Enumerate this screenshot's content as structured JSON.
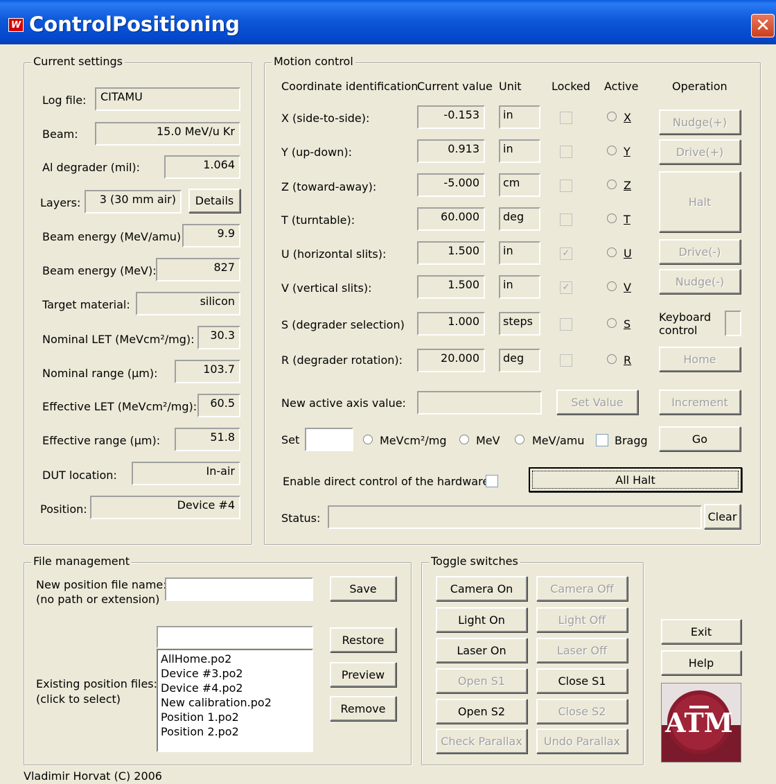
{
  "window": {
    "title": "ControlPositioning",
    "close_glyph": "✕",
    "app_icon": "app-icon"
  },
  "settings": {
    "legend": "Current settings",
    "log_label": "Log file:",
    "log_value": "CITAMU",
    "beam_label": "Beam:",
    "beam_value": "15.0 MeV/u  Kr",
    "al_label": "Al degrader (mil):",
    "al_value": "1.064",
    "layers_label": "Layers:",
    "layers_value": "3 (30 mm air)",
    "details_btn": "Details",
    "be_amu_label": "Beam energy (MeV/amu):",
    "be_amu_value": "9.9",
    "be_label": "Beam energy (MeV):",
    "be_value": "827",
    "target_label": "Target material:",
    "target_value": "silicon",
    "nlet_label": "Nominal LET (MeVcm²/mg):",
    "nlet_value": "30.3",
    "nrange_label": "Nominal range (µm):",
    "nrange_value": "103.7",
    "elet_label": "Effective LET (MeVcm²/mg):",
    "elet_value": "60.5",
    "erange_label": "Effective range (µm):",
    "erange_value": "51.8",
    "dut_label": "DUT location:",
    "dut_value": "In-air",
    "pos_label": "Position:",
    "pos_value": "Device #4"
  },
  "motion": {
    "legend": "Motion control",
    "headers": {
      "coord": "Coordinate identification",
      "current": "Current value",
      "unit": "Unit",
      "locked": "Locked",
      "active": "Active",
      "operation": "Operation"
    },
    "axes": [
      {
        "label": "X (side-to-side):",
        "value": "-0.153",
        "unit": "in",
        "locked": false,
        "key": "X"
      },
      {
        "label": "Y (up-down):",
        "value": "0.913",
        "unit": "in",
        "locked": false,
        "key": "Y"
      },
      {
        "label": "Z (toward-away):",
        "value": "-5.000",
        "unit": "cm",
        "locked": false,
        "key": "Z"
      },
      {
        "label": "T (turntable):",
        "value": "60.000",
        "unit": "deg",
        "locked": false,
        "key": "T"
      },
      {
        "label": "U (horizontal slits):",
        "value": "1.500",
        "unit": "in",
        "locked": true,
        "key": "U"
      },
      {
        "label": "V (vertical slits):",
        "value": "1.500",
        "unit": "in",
        "locked": true,
        "key": "V"
      },
      {
        "label": "S (degrader selection)",
        "value": "1.000",
        "unit": "steps",
        "locked": false,
        "key": "S"
      },
      {
        "label": "R (degrader rotation):",
        "value": "20.000",
        "unit": "deg",
        "locked": false,
        "key": "R"
      }
    ],
    "ops": {
      "nudge_plus": "Nudge(+)",
      "drive_plus": "Drive(+)",
      "halt": "Halt",
      "drive_minus": "Drive(-)",
      "nudge_minus": "Nudge(-)",
      "keyboard": "Keyboard control",
      "home": "Home",
      "increment": "Increment",
      "go": "Go"
    },
    "new_value_label": "New active axis value:",
    "set_value_btn": "Set Value",
    "set_label": "Set",
    "opt_let": "MeVcm²/mg",
    "opt_mev": "MeV",
    "opt_amu": "MeV/amu",
    "opt_bragg": "Bragg",
    "enable_label": "Enable direct control of the hardware",
    "all_halt": "All Halt",
    "status_label": "Status:",
    "status_value": "",
    "clear_btn": "Clear"
  },
  "files": {
    "legend": "File management",
    "new_label1": "New position file name:",
    "new_label2": "(no path or extension)",
    "save_btn": "Save",
    "restore_btn": "Restore",
    "preview_btn": "Preview",
    "remove_btn": "Remove",
    "existing_label1": "Existing position files:",
    "existing_label2": "(click to select)",
    "list": [
      "AllHome.po2",
      "Device #3.po2",
      "Device #4.po2",
      "New calibration.po2",
      "Position 1.po2",
      "Position 2.po2"
    ]
  },
  "toggles": {
    "legend": "Toggle switches",
    "camera_on": "Camera On",
    "camera_off": "Camera Off",
    "light_on": "Light On",
    "light_off": "Light Off",
    "laser_on": "Laser On",
    "laser_off": "Laser Off",
    "open_s1": "Open S1",
    "close_s1": "Close S1",
    "open_s2": "Open S2",
    "close_s2": "Close S2",
    "check_parallax": "Check Parallax",
    "undo_parallax": "Undo Parallax"
  },
  "side": {
    "exit_btn": "Exit",
    "help_btn": "Help",
    "logo_text": "ATM"
  },
  "footer": "Vladimir Horvat (C) 2006"
}
